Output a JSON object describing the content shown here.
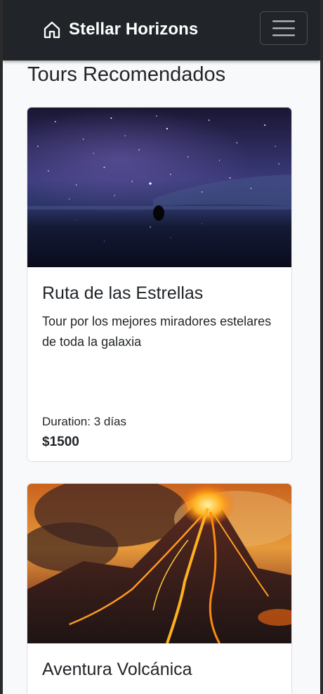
{
  "navbar": {
    "brand": "Stellar Horizons",
    "brand_icon": "house-icon",
    "menu_icon": "hamburger-menu-icon"
  },
  "page": {
    "section_title": "Tours Recomendados"
  },
  "tours": [
    {
      "title": "Ruta de las Estrellas",
      "description": "Tour por los mejores miradores estelares de toda la galaxia",
      "duration": "Duration: 3 días",
      "price": "$1500",
      "image": "starry-sky-salt-flat-image"
    },
    {
      "title": "Aventura Volcánica",
      "image": "erupting-volcano-image"
    }
  ],
  "colors": {
    "navbar_bg": "#212529",
    "page_bg": "#f8f9fa",
    "card_bg": "#ffffff"
  }
}
